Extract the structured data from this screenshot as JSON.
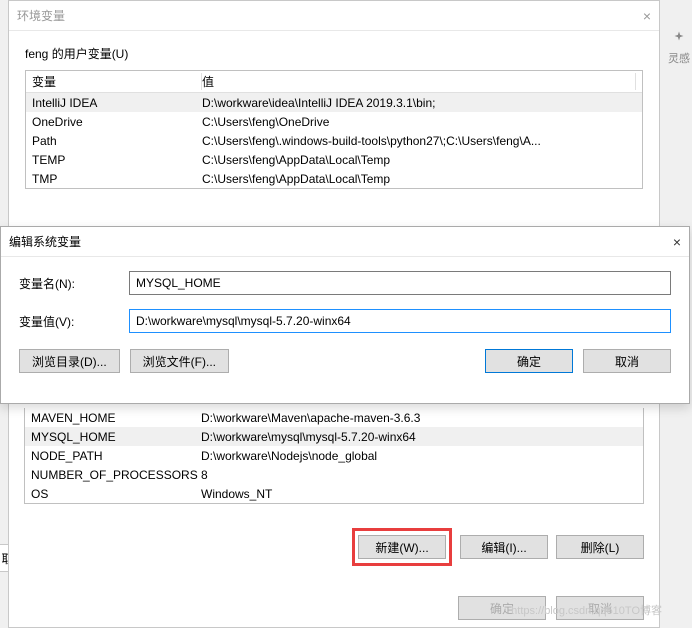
{
  "rightPanel": {
    "label": "灵感"
  },
  "envWindow": {
    "title": "环境变量",
    "userSection": {
      "label": "feng 的用户变量(U)",
      "columns": {
        "name": "变量",
        "value": "值"
      },
      "rows": [
        {
          "name": "IntelliJ IDEA",
          "value": "D:\\workware\\idea\\IntelliJ IDEA 2019.3.1\\bin;"
        },
        {
          "name": "OneDrive",
          "value": "C:\\Users\\feng\\OneDrive"
        },
        {
          "name": "Path",
          "value": "C:\\Users\\feng\\.windows-build-tools\\python27\\;C:\\Users\\feng\\A..."
        },
        {
          "name": "TEMP",
          "value": "C:\\Users\\feng\\AppData\\Local\\Temp"
        },
        {
          "name": "TMP",
          "value": "C:\\Users\\feng\\AppData\\Local\\Temp"
        }
      ]
    },
    "sysSection": {
      "rows": [
        {
          "name": "MAVEN_HOME",
          "value": "D:\\workware\\Maven\\apache-maven-3.6.3"
        },
        {
          "name": "MYSQL_HOME",
          "value": "D:\\workware\\mysql\\mysql-5.7.20-winx64"
        },
        {
          "name": "NODE_PATH",
          "value": "D:\\workware\\Nodejs\\node_global"
        },
        {
          "name": "NUMBER_OF_PROCESSORS",
          "value": "8"
        },
        {
          "name": "OS",
          "value": "Windows_NT"
        }
      ],
      "buttons": {
        "new": "新建(W)...",
        "edit": "编辑(I)...",
        "delete": "删除(L)"
      }
    },
    "footer": {
      "ok": "确定",
      "cancel": "取消"
    }
  },
  "editWindow": {
    "title": "编辑系统变量",
    "nameLabel": "变量名(N):",
    "nameValue": "MYSQL_HOME",
    "valueLabel": "变量值(V):",
    "valueValue": "D:\\workware\\mysql\\mysql-5.7.20-winx64",
    "buttons": {
      "browseDir": "浏览目录(D)...",
      "browseFile": "浏览文件(F)...",
      "ok": "确定",
      "cancel": "取消"
    }
  },
  "leftTab": "取",
  "watermark": "https://blog.csdn.qq510TO博客"
}
